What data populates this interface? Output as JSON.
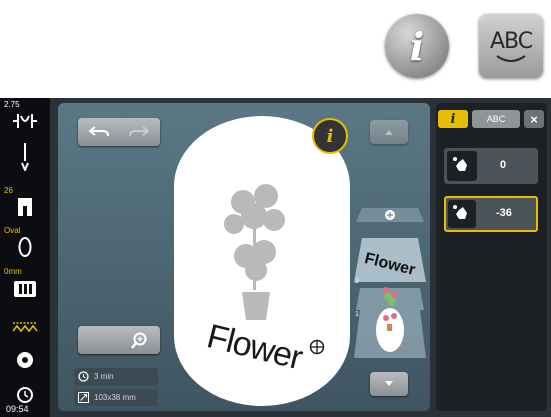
{
  "header_buttons": {
    "info_glyph": "i",
    "text_arc_label": "ABC"
  },
  "left_bar": {
    "needle_value": "2.75",
    "foot_number": "26",
    "hoop_label": "Oval",
    "thread_label": "0mm",
    "clock_time": "09:54"
  },
  "main": {
    "info_glyph": "i",
    "time_label": "3 min",
    "size_label": "103x38 mm",
    "design_word": "Flower",
    "layer_word": "Flower",
    "layer_numbers": [
      "2",
      "1"
    ]
  },
  "right_panel": {
    "tab_info_glyph": "i",
    "tab_abc_label": "ABC",
    "close_glyph": "×",
    "rows": [
      {
        "value": "0"
      },
      {
        "value": "-36"
      }
    ]
  },
  "colors": {
    "accent_yellow": "#e6c000",
    "screen_bg": "#2a3137",
    "panel_bg": "#1b2125"
  }
}
